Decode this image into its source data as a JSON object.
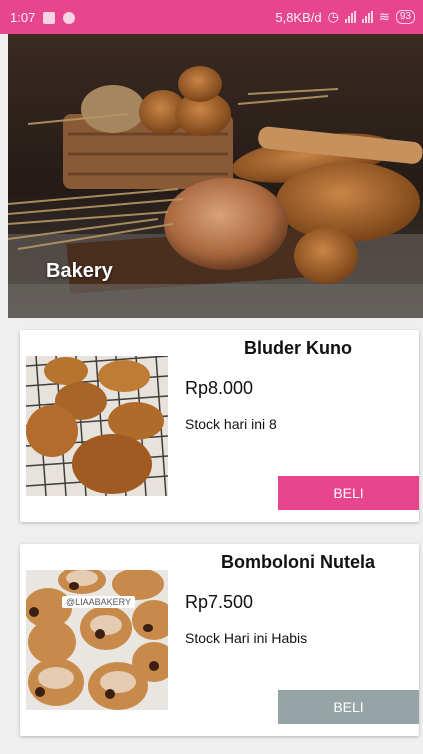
{
  "status_bar": {
    "time": "1:07",
    "network_speed": "5,8KB/d",
    "battery": "93"
  },
  "hero": {
    "title": "Bakery"
  },
  "products": [
    {
      "name": "Bluder Kuno",
      "price": "Rp8.000",
      "stock": "Stock hari ini 8",
      "button": "BELI",
      "button_color": "#e8458f"
    },
    {
      "name": "Bomboloni Nutela",
      "price": "Rp7.500",
      "stock": "Stock Hari ini Habis",
      "button": "BELI",
      "button_color": "#96a4a6",
      "image_tag": "@LIAABAKERY"
    }
  ],
  "colors": {
    "accent": "#e8458f",
    "disabled": "#96a4a6"
  }
}
